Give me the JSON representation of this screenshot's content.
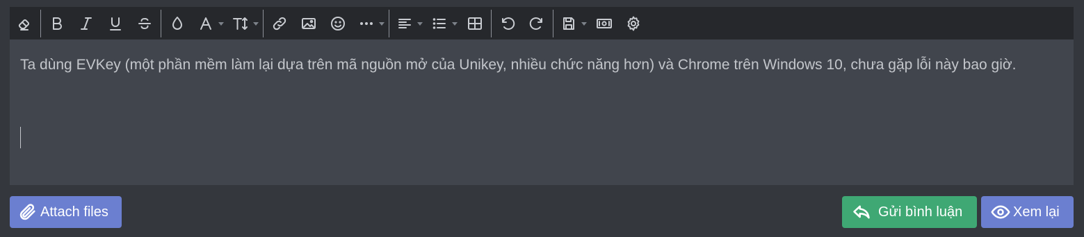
{
  "toolbar": {
    "buttons": [
      {
        "name": "eraser-icon",
        "title": "Remove formatting"
      },
      {
        "name": "bold-icon",
        "title": "Bold"
      },
      {
        "name": "italic-icon",
        "title": "Italic"
      },
      {
        "name": "underline-icon",
        "title": "Underline"
      },
      {
        "name": "strikethrough-icon",
        "title": "Strike through"
      },
      {
        "name": "droplet-icon",
        "title": "Text color"
      },
      {
        "name": "font-family-icon",
        "title": "Font family"
      },
      {
        "name": "font-size-icon",
        "title": "Font size"
      },
      {
        "name": "link-icon",
        "title": "Insert link"
      },
      {
        "name": "image-icon",
        "title": "Insert image"
      },
      {
        "name": "smile-icon",
        "title": "Smilies"
      },
      {
        "name": "more-icon",
        "title": "More options"
      },
      {
        "name": "align-left-icon",
        "title": "Alignment"
      },
      {
        "name": "list-icon",
        "title": "List"
      },
      {
        "name": "table-icon",
        "title": "Insert table"
      },
      {
        "name": "undo-icon",
        "title": "Undo"
      },
      {
        "name": "redo-icon",
        "title": "Redo"
      },
      {
        "name": "save-icon",
        "title": "Drafts"
      },
      {
        "name": "money-icon",
        "title": "Insert price"
      },
      {
        "name": "gear-icon",
        "title": "Toggle BB code"
      }
    ]
  },
  "editor": {
    "text": "Ta dùng EVKey (một phần mềm làm lại dựa trên mã nguồn mở của Unikey, nhiều chức năng hơn) và Chrome trên Windows 10, chưa gặp lỗi này bao giờ."
  },
  "actions": {
    "attach_label": "Attach files",
    "submit_label": "Gửi bình luận",
    "preview_label": "Xem lại"
  },
  "colors": {
    "page_bg": "#34373d",
    "editor_bg": "#41454d",
    "toolbar_bg": "#26282c",
    "primary": "#6b7fd0",
    "success": "#3fa874"
  }
}
